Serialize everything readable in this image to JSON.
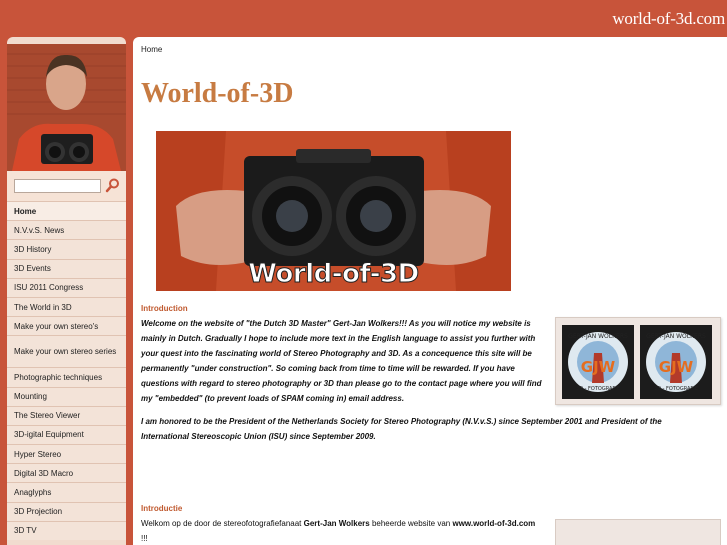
{
  "header": {
    "site_name": "world-of-3d.com"
  },
  "search": {
    "placeholder": ""
  },
  "nav": {
    "items": [
      {
        "label": "Home"
      },
      {
        "label": "N.V.v.S. News"
      },
      {
        "label": "3D History"
      },
      {
        "label": "3D Events"
      },
      {
        "label": "ISU 2011 Congress"
      },
      {
        "label": "The World in 3D"
      },
      {
        "label": "Make your own stereo's"
      },
      {
        "label": "Make your own stereo series"
      },
      {
        "label": "Photographic techniques"
      },
      {
        "label": "Mounting"
      },
      {
        "label": "The Stereo Viewer"
      },
      {
        "label": "3D-igital Equipment"
      },
      {
        "label": "Hyper Stereo"
      },
      {
        "label": "Digital 3D Macro"
      },
      {
        "label": "Anaglyphs"
      },
      {
        "label": "3D Projection"
      },
      {
        "label": "3D TV"
      }
    ]
  },
  "breadcrumb": "Home",
  "page": {
    "title": "World-of-3D",
    "hero_text": "World-of-3D",
    "intro_heading": "Introduction",
    "intro_paragraph": "Welcome on the website of \"the Dutch 3D Master\" Gert-Jan Wolkers!!! As you will notice my website is mainly in Dutch. Gradually I hope to include more text in the English language to assist you further with your quest into the fascinating world of Stereo Photography and 3D. As a concequence this site will be permanently \"under construction\". So coming back from time to time will be rewarded. If you have questions with regard to stereo photography or 3D than please go to the contact page where you will find my \"embedded\" (to prevent loads of SPAM coming in) email address.",
    "honor_paragraph": "I am honored to be the President of the Netherlands Society for Stereo Photography (N.V.v.S.) since September 2001 and President of the International Stereoscopic Union (ISU) since September 2009.",
    "dutch_heading": "Introductie",
    "dutch_text_a": "Welkom op de door de stereofotografiefanaat ",
    "dutch_name": "Gert-Jan Wolkers",
    "dutch_text_b": " beheerde website van ",
    "dutch_url": "www.world-of-3d.com",
    "dutch_text_c": " !!!",
    "logo_ring_text": "GERT-JAN WOLKERS",
    "logo_initials": "GJW",
    "logo_bottom_text": "3D - FOTOGRAFIE"
  },
  "colors": {
    "brand": "#c8543a",
    "title": "#c77b42",
    "heading": "#c05a30"
  }
}
